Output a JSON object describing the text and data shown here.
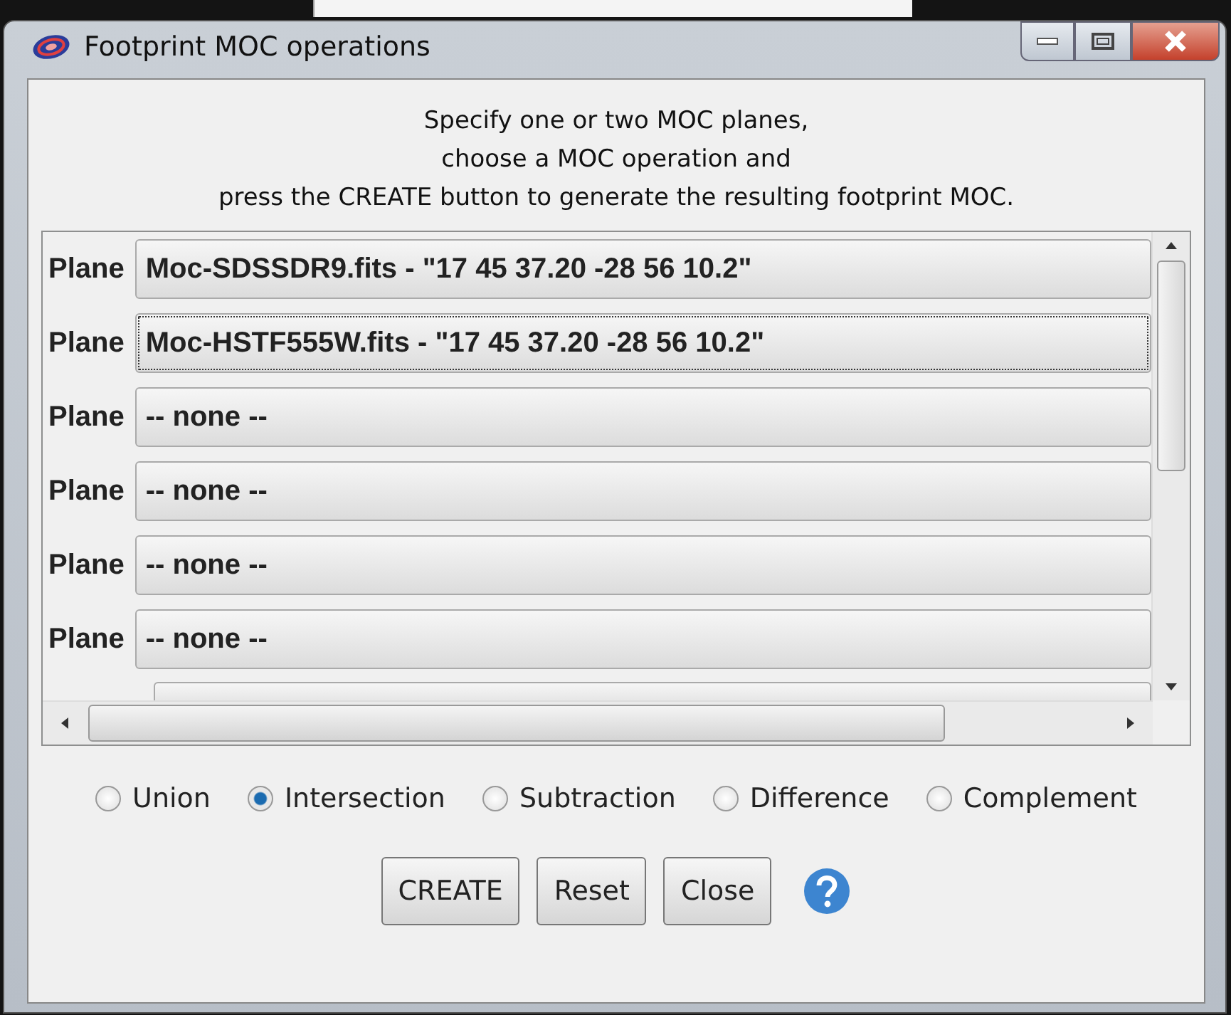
{
  "window": {
    "title": "Footprint MOC operations"
  },
  "instructions": [
    "Specify one or two MOC planes,",
    "choose a MOC operation and",
    "press the CREATE button to generate the resulting footprint MOC."
  ],
  "planes": [
    {
      "label": "Plane",
      "value": "Moc-SDSSDR9.fits - \"17 45 37.20 -28 56 10.2\"",
      "focused": false
    },
    {
      "label": "Plane",
      "value": "Moc-HSTF555W.fits - \"17 45 37.20 -28 56 10.2\"",
      "focused": true
    },
    {
      "label": "Plane",
      "value": "-- none --",
      "focused": false
    },
    {
      "label": "Plane",
      "value": "-- none --",
      "focused": false
    },
    {
      "label": "Plane",
      "value": "-- none --",
      "focused": false
    },
    {
      "label": "Plane",
      "value": "-- none --",
      "focused": false
    }
  ],
  "operations": [
    {
      "label": "Union",
      "selected": false
    },
    {
      "label": "Intersection",
      "selected": true
    },
    {
      "label": "Subtraction",
      "selected": false
    },
    {
      "label": "Difference",
      "selected": false
    },
    {
      "label": "Complement",
      "selected": false
    }
  ],
  "buttons": [
    "CREATE",
    "Reset",
    "Close"
  ]
}
